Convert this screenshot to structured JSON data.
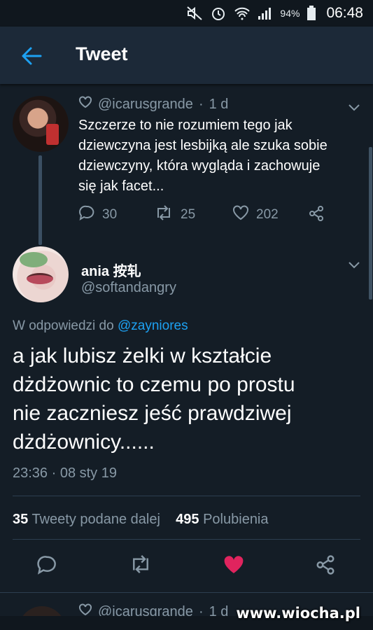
{
  "status_bar": {
    "battery": "94%",
    "time": "06:48",
    "icons": [
      "mute-icon",
      "alarm-icon",
      "wifi-icon",
      "signal-icon",
      "battery-icon"
    ]
  },
  "app_bar": {
    "title": "Tweet",
    "back_icon": "arrow-left-icon"
  },
  "parent_tweet": {
    "handle": "@icarusgrande",
    "age": "1 d",
    "text": "Szczerze to nie rozumiem tego jak\ndziewczyna jest lesbijką ale szuka sobie\ndziewczyny, która wygląda i zachowuje\nsię jak facet...",
    "replies": "30",
    "retweets": "25",
    "likes": "202"
  },
  "main_tweet": {
    "name": "ania 按轧",
    "handle": "@softandangry",
    "reply_prefix": "W odpowiedzi do",
    "reply_to": "@zayniores",
    "text": "a jak lubisz żelki w kształcie\ndżdżownic to czemu po prostu\nnie zaczniesz jeść prawdziwej\ndżdżownicy......",
    "timestamp": "23:36 · 08 sty 19",
    "retweets_count": "35",
    "retweets_label": "Tweety podane dalej",
    "likes_count": "495",
    "likes_label": "Polubienia",
    "liked": true,
    "like_color": "#e0245e"
  },
  "next_tweet": {
    "handle": "@icarusgrande",
    "age": "1 d"
  },
  "watermark": "www.wiocha.pl",
  "colors": {
    "background": "#141d26",
    "app_bar": "#1c2938",
    "accent": "#1da1f2",
    "secondary_text": "#8899a6"
  }
}
